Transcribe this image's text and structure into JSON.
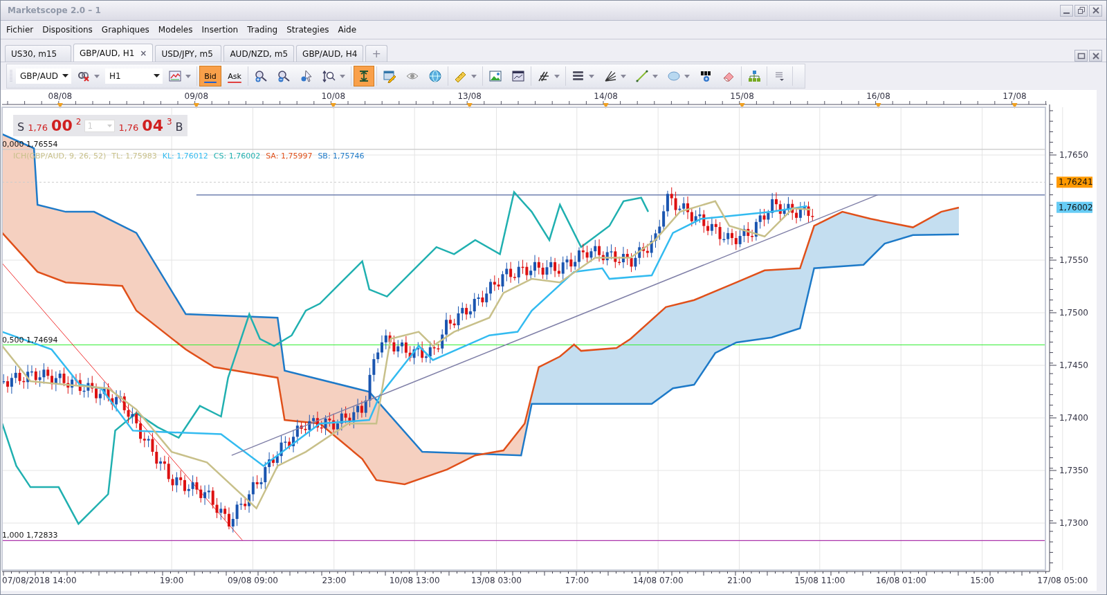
{
  "window": {
    "title": "Marketscope 2.0 – 1"
  },
  "menu": [
    "Fichier",
    "Dispositions",
    "Graphiques",
    "Modeles",
    "Insertion",
    "Trading",
    "Strategies",
    "Aide"
  ],
  "tabs": [
    {
      "label": "US30, m15",
      "selected": false
    },
    {
      "label": "GBP/AUD, H1",
      "selected": true,
      "close": "×"
    },
    {
      "label": "USD/JPY, m5",
      "selected": false
    },
    {
      "label": "AUD/NZD, m5",
      "selected": false
    },
    {
      "label": "GBP/AUD, H4",
      "selected": false
    }
  ],
  "add_tab": "+",
  "toolbar": [
    {
      "kind": "select",
      "value": "GBP/AUD"
    },
    {
      "kind": "tool",
      "selected": false,
      "dropdown": true
    },
    {
      "kind": "select",
      "value": "H1"
    },
    {
      "kind": "tool",
      "selected": false,
      "dropdown": true
    },
    {
      "kind": "toggle",
      "label": "Bid",
      "selected": true
    },
    {
      "kind": "toggle",
      "label": "Ask",
      "selected": false
    },
    {
      "kind": "tool",
      "selected": false,
      "dropdown": false
    },
    {
      "kind": "tool",
      "selected": false,
      "dropdown": false
    },
    {
      "kind": "tool",
      "selected": false,
      "dropdown": false
    },
    {
      "kind": "tool",
      "selected": false,
      "dropdown": true
    },
    {
      "kind": "tool",
      "selected": true,
      "dropdown": false
    },
    {
      "kind": "tool",
      "selected": false,
      "dropdown": false
    },
    {
      "kind": "tool",
      "selected": false,
      "dropdown": false
    },
    {
      "kind": "tool",
      "selected": false,
      "dropdown": false
    },
    {
      "kind": "tool",
      "selected": false,
      "dropdown": true
    },
    {
      "kind": "tool",
      "selected": false,
      "dropdown": false
    },
    {
      "kind": "tool",
      "selected": false,
      "dropdown": false
    },
    {
      "kind": "tool",
      "selected": false,
      "dropdown": true
    },
    {
      "kind": "tool",
      "selected": false,
      "dropdown": true
    },
    {
      "kind": "tool",
      "selected": false,
      "dropdown": true
    },
    {
      "kind": "tool",
      "selected": false,
      "dropdown": true
    },
    {
      "kind": "tool",
      "selected": false,
      "dropdown": true
    },
    {
      "kind": "tool",
      "selected": false,
      "dropdown": false
    },
    {
      "kind": "tool",
      "selected": false,
      "dropdown": false
    },
    {
      "kind": "tool",
      "selected": false,
      "dropdown": false
    },
    {
      "kind": "tool",
      "selected": false,
      "dropdown": false
    }
  ],
  "date_strip": [
    "08/08",
    "09/08",
    "10/08",
    "13/08",
    "14/08",
    "15/08",
    "16/08",
    "17/08"
  ],
  "quote": {
    "sell_label": "S",
    "sell_big": "1,76",
    "sell_pips": "00",
    "sell_frac": "2",
    "amount": "1",
    "buy_big": "1,76",
    "buy_pips": "04",
    "buy_frac": "3",
    "buy_label": "B"
  },
  "legend": [
    {
      "text": "ICH(GBP/AUD, 9, 26, 52)",
      "color": "#c8c08a"
    },
    {
      "text": "TL: 1,75983",
      "color": "#c8c08a"
    },
    {
      "text": "KL: 1,76012",
      "color": "#33bbf0"
    },
    {
      "text": "CS: 1,76002",
      "color": "#20b0b0"
    },
    {
      "text": "SA: 1,75997",
      "color": "#e0501a"
    },
    {
      "text": "SB: 1,75746",
      "color": "#1e7ac8"
    }
  ],
  "fibonacci": [
    "0,000 1,76554",
    "0,500 1,74694",
    "1,000 1,72833"
  ],
  "price_axis": [
    "1,7650",
    "1,7550",
    "1,7500",
    "1,7450",
    "1,7400",
    "1,7350",
    "1,7300"
  ],
  "price_tags": [
    {
      "text": "1,76241",
      "color": "#ff9900"
    },
    {
      "text": "1,76002",
      "color": "#66ccf5"
    }
  ],
  "time_axis": [
    "07/08/2018 14:00",
    "19:00",
    "09/08 09:00",
    "23:00",
    "10/08 13:00",
    "13/08 03:00",
    "17:00",
    "14/08 07:00",
    "21:00",
    "15/08 11:00",
    "16/08 01:00",
    "15:00",
    "17/08 05:00"
  ]
}
